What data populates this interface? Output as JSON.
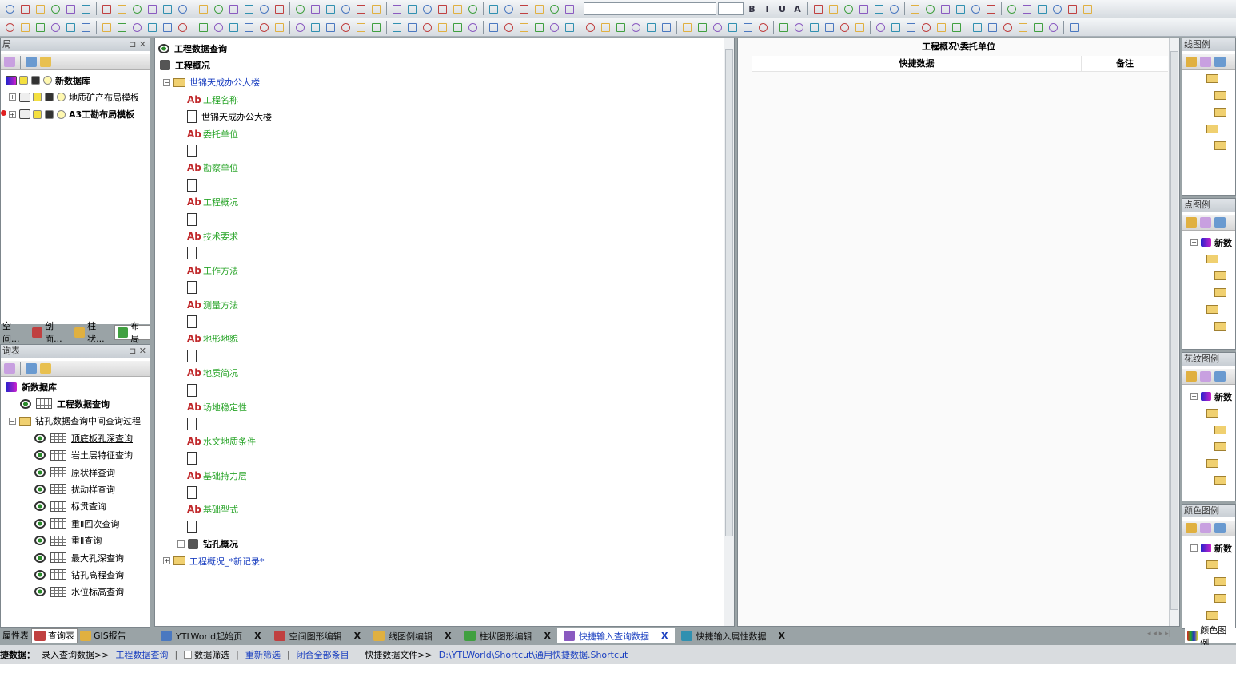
{
  "toolbar": {
    "font_size_combo": "",
    "font_combo": "",
    "bold": "B",
    "italic": "I",
    "underline": "U",
    "font_color": "A"
  },
  "layout_panel": {
    "title": "局",
    "tree": [
      {
        "label": "新数据库",
        "bold": true
      },
      {
        "label": "地质矿产布局模板"
      },
      {
        "label": "A3工勘布局模板",
        "bold": true
      }
    ],
    "tabs": [
      "空间...",
      "剖面...",
      "柱状...",
      "布局"
    ],
    "active_tab": 3
  },
  "query_panel": {
    "title": "询表",
    "root": "新数据库",
    "top_query": "工程数据查询",
    "folder": "钻孔数据查询中间查询过程",
    "queries": [
      "顶底板孔深查询",
      "岩土层特征查询",
      "原状样查询",
      "扰动样查询",
      "标贯查询",
      "重Ⅱ回次查询",
      "重Ⅱ查询",
      "最大孔深查询",
      "钻孔高程查询",
      "水位标高查询"
    ],
    "tabs": [
      "属性表",
      "查询表",
      "GIS报告"
    ],
    "active_tab": 1
  },
  "shortcut_tree": {
    "query": "工程数据查询",
    "table": "工程概况",
    "record": "世锦天成办公大楼",
    "fields": [
      {
        "name": "工程名称",
        "value": "世锦天成办公大楼"
      },
      {
        "name": "委托单位",
        "value": ""
      },
      {
        "name": "勘察单位",
        "value": ""
      },
      {
        "name": "工程概况",
        "value": ""
      },
      {
        "name": "技术要求",
        "value": ""
      },
      {
        "name": "工作方法",
        "value": ""
      },
      {
        "name": "测量方法",
        "value": ""
      },
      {
        "name": "地形地貌",
        "value": ""
      },
      {
        "name": "地质简况",
        "value": ""
      },
      {
        "name": "场地稳定性",
        "value": ""
      },
      {
        "name": "水文地质条件",
        "value": ""
      },
      {
        "name": "基础持力层",
        "value": ""
      },
      {
        "name": "基础型式",
        "value": ""
      }
    ],
    "sub_table": "钻孔概况",
    "new_record": "工程概况_*新记录*"
  },
  "data_grid": {
    "title": "工程概况\\委托单位",
    "columns": [
      "快捷数据",
      "备注"
    ]
  },
  "doc_tabs": [
    {
      "label": "YTLWorld起始页",
      "icon": "home-icon"
    },
    {
      "label": "空间图形编辑",
      "icon": "globe-icon"
    },
    {
      "label": "线图例编辑",
      "icon": "line-legend-icon"
    },
    {
      "label": "柱状图形编辑",
      "icon": "column-chart-icon"
    },
    {
      "label": "快捷输入查询数据",
      "icon": "query-icon",
      "active": true
    },
    {
      "label": "快捷输入属性数据",
      "icon": "table-icon"
    }
  ],
  "close_label": "X",
  "right_panels": [
    {
      "title": "线图例"
    },
    {
      "title": "点图例",
      "root": "新数"
    },
    {
      "title": "花纹图例",
      "root": "新数"
    },
    {
      "title": "颜色图例",
      "root": "新数"
    }
  ],
  "right_bottom_tab": "颜色图例",
  "status": {
    "label": "捷数据：",
    "entry": "录入查询数据>>",
    "entry_link": "工程数据查询",
    "filter": "数据筛选",
    "refilter": "重新筛选",
    "collapse": "闭合全部条目",
    "file_label": "快捷数据文件>>",
    "file_path": "D:\\YTLWorld\\Shortcut\\通用快捷数据.Shortcut"
  },
  "colors": {
    "link": "#1a3fc0",
    "field": "#2aa52a",
    "active_tab": "#ffffff"
  }
}
